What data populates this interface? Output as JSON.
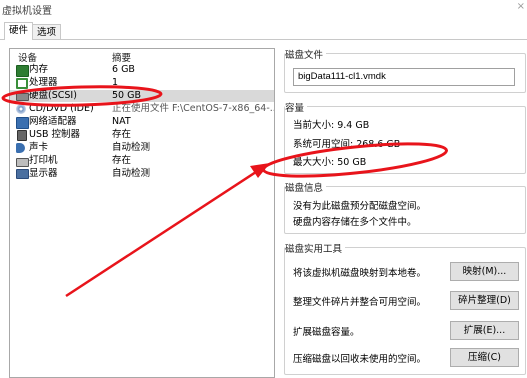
{
  "window": {
    "title": "虚拟机设置",
    "close_glyph": "×"
  },
  "tabs": [
    {
      "label": "硬件",
      "active": true
    },
    {
      "label": "选项",
      "active": false
    }
  ],
  "device_list": {
    "col_device": "设备",
    "col_summary": "摘要",
    "rows": [
      {
        "name": "内存",
        "summary": "6 GB",
        "icon": "memory-icon",
        "color": "#2e7d32"
      },
      {
        "name": "处理器",
        "summary": "1",
        "icon": "processor-icon",
        "color": "#3a8f3a"
      },
      {
        "name": "硬盘(SCSI)",
        "summary": "50 GB",
        "icon": "hard-disk-icon",
        "color": "#707070",
        "selected": true
      },
      {
        "name": "CD/DVD (IDE)",
        "summary": "正在使用文件 F:\\CentOS-7-x86_64-...",
        "icon": "cd-dvd-icon",
        "color": "#5a7fb0"
      },
      {
        "name": "网络适配器",
        "summary": "NAT",
        "icon": "network-adapter-icon",
        "color": "#3a6fb0"
      },
      {
        "name": "USB 控制器",
        "summary": "存在",
        "icon": "usb-icon",
        "color": "#555555"
      },
      {
        "name": "声卡",
        "summary": "自动检测",
        "icon": "sound-card-icon",
        "color": "#3a6fb0"
      },
      {
        "name": "打印机",
        "summary": "存在",
        "icon": "printer-icon",
        "color": "#5a5a5a"
      },
      {
        "name": "显示器",
        "summary": "自动检测",
        "icon": "display-icon",
        "color": "#4a6fa0"
      }
    ]
  },
  "disk_file": {
    "title": "磁盘文件",
    "value": "bigData111-cl1.vmdk"
  },
  "capacity": {
    "title": "容量",
    "current": "当前大小: 9.4 GB",
    "available": "系统可用空间: 268.6 GB",
    "max": "最大大小: 50 GB"
  },
  "disk_info": {
    "title": "磁盘信息",
    "line1": "没有为此磁盘预分配磁盘空间。",
    "line2": "硬盘内容存储在多个文件中。"
  },
  "utilities": {
    "title": "磁盘实用工具",
    "map_desc": "将该虚拟机磁盘映射到本地卷。",
    "map_btn": "映射(M)...",
    "defrag_desc": "整理文件碎片并整合可用空间。",
    "defrag_btn": "碎片整理(D)",
    "expand_desc": "扩展磁盘容量。",
    "expand_btn": "扩展(E)...",
    "compact_desc": "压缩磁盘以回收未使用的空间。",
    "compact_btn": "压缩(C)"
  },
  "annotation": {
    "color": "#e8141b"
  }
}
